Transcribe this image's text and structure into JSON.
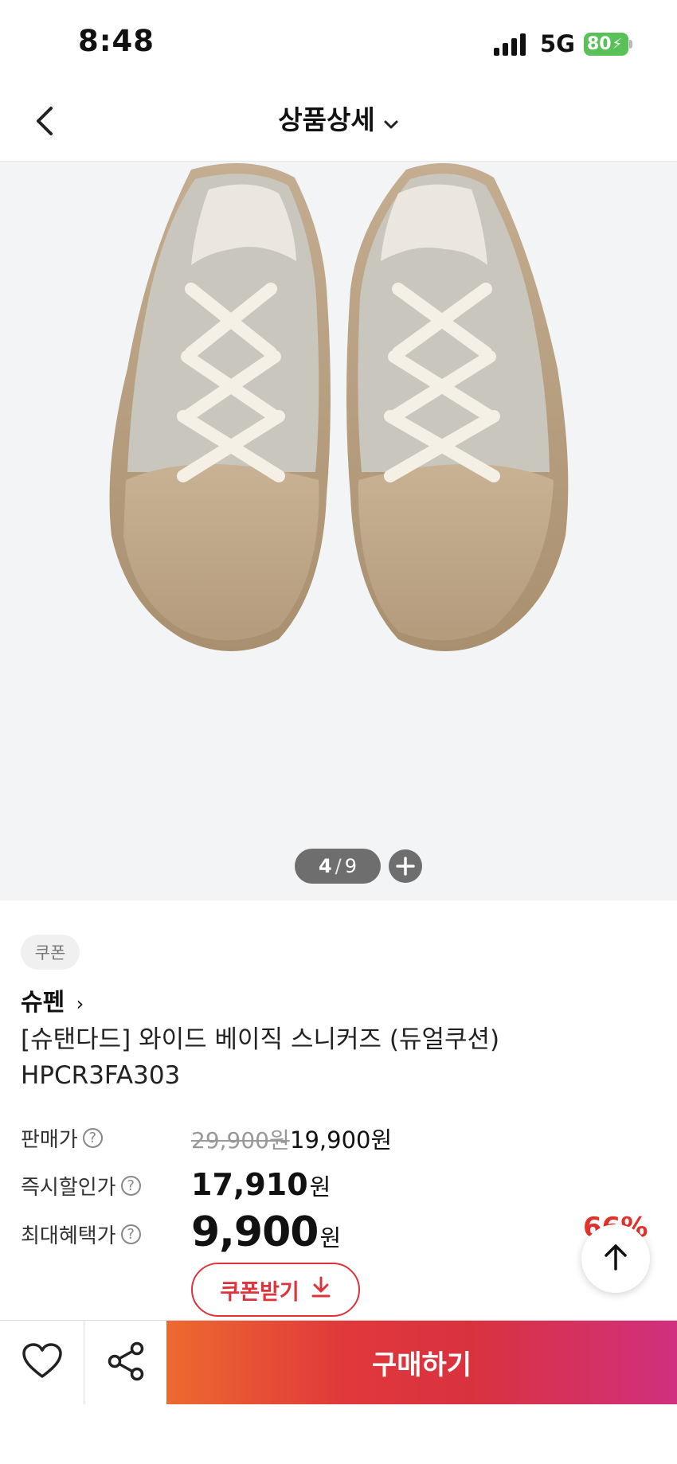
{
  "status_bar": {
    "time": "8:48",
    "network": "5G",
    "battery": "80"
  },
  "header": {
    "title": "상품상세"
  },
  "gallery": {
    "current": "4",
    "total": "9",
    "progress_fraction": 0.444
  },
  "product": {
    "coupon_tag": "쿠폰",
    "brand": "슈펜",
    "name_line1": "[슈탠다드] 와이드 베이직 스니커즈 (듀얼쿠션)",
    "name_line2": "HPCR3FA303"
  },
  "pricing": {
    "sale_label": "판매가",
    "original_price": "29,900원",
    "sale_price": "19,900원",
    "instant_label": "즉시할인가",
    "instant_price": "17,910",
    "max_label": "최대혜택가",
    "max_price": "9,900",
    "currency": "원",
    "discount_pct": "66%",
    "help_symbol": "?"
  },
  "actions": {
    "coupon_button": "쿠폰받기",
    "buy_button": "구매하기"
  },
  "icons": [
    "back-icon",
    "chevron-down-icon",
    "plus-icon",
    "help-icon",
    "download-icon",
    "arrow-up-icon",
    "heart-icon",
    "share-icon"
  ],
  "colors": {
    "accent_red": "#e0323a",
    "battery_green": "#5ac158",
    "buy_gradient_start": "#ed6a2f",
    "buy_gradient_end": "#d0307f"
  }
}
